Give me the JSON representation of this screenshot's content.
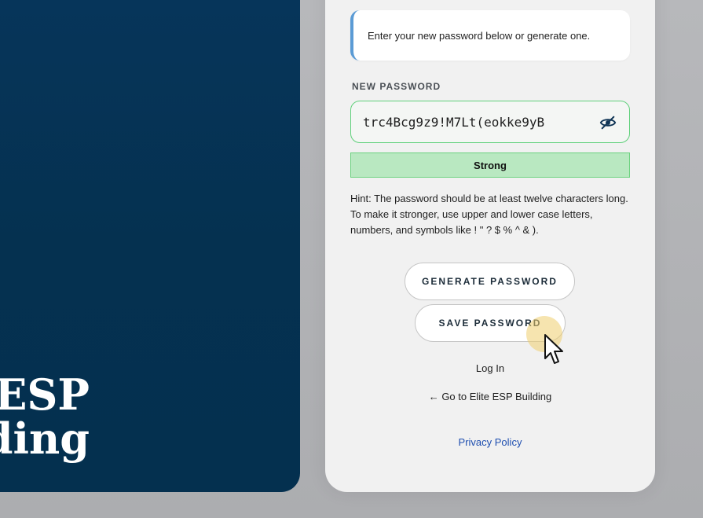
{
  "hero": {
    "title_line1": "ESP",
    "title_line2": "ding"
  },
  "form": {
    "info_text": "Enter your new password below or generate one.",
    "password_label": "NEW PASSWORD",
    "password_value": "trc4Bcg9z9!M7Lt(eokke9yB",
    "strength_text": "Strong",
    "hint": "Hint: The password should be at least twelve characters long. To make it stronger, use upper and lower case letters, numbers, and symbols like ! \" ? $ % ^ & ).",
    "generate_label": "GENERATE PASSWORD",
    "save_label": "SAVE PASSWORD"
  },
  "links": {
    "login": "Log In",
    "back": "← Go to Elite ESP Building",
    "privacy": "Privacy Policy"
  },
  "colors": {
    "hero_bg": "#053150",
    "strong_bg": "#b9e8c1",
    "field_border": "#5fd07a",
    "info_accent": "#5b9bd5",
    "privacy_link": "#1f4fb0"
  },
  "icons": {
    "toggle_visibility": "eye-slash-icon",
    "pointer": "mouse-pointer-icon"
  }
}
